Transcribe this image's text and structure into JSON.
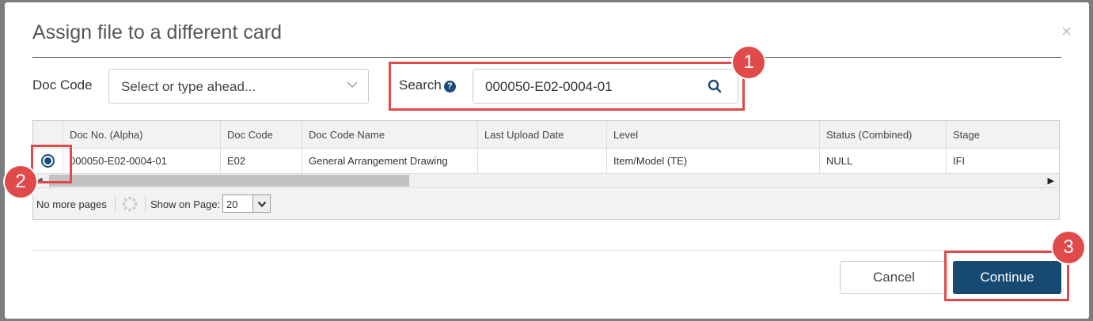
{
  "dialog": {
    "title": "Assign file to a different card",
    "close_glyph": "×"
  },
  "filters": {
    "doc_code_label": "Doc Code",
    "doc_code_placeholder": "Select or type ahead...",
    "search_label": "Search",
    "search_value": "000050-E02-0004-01",
    "help_glyph": "?"
  },
  "grid": {
    "columns": [
      "Doc No. (Alpha)",
      "Doc Code",
      "Doc Code Name",
      "Last Upload Date",
      "Level",
      "Status (Combined)",
      "Stage"
    ],
    "rows": [
      {
        "selected": true,
        "cells": [
          "000050-E02-0004-01",
          "E02",
          "General Arrangement Drawing",
          "",
          "Item/Model (TE)",
          "NULL",
          "IFI"
        ]
      }
    ]
  },
  "pager": {
    "status": "No more pages",
    "show_label": "Show on Page:",
    "page_size": "20"
  },
  "footer": {
    "cancel_label": "Cancel",
    "continue_label": "Continue"
  },
  "annotations": {
    "step1": "1",
    "step2": "2",
    "step3": "3",
    "color": "#e04a4a"
  },
  "colors": {
    "primary": "#164a72",
    "highlight": "#e04a4a"
  }
}
